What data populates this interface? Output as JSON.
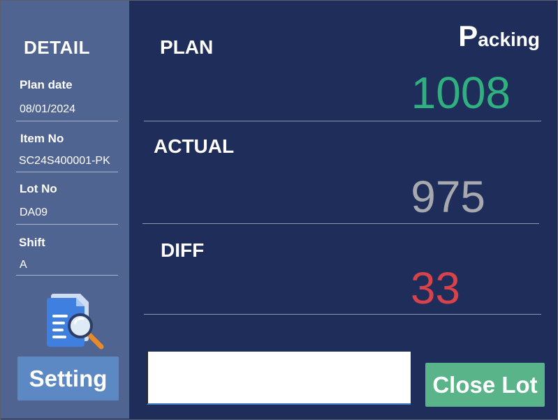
{
  "sidebar": {
    "title": "DETAIL",
    "fields": [
      {
        "label": "Plan date",
        "value": "08/01/2024"
      },
      {
        "label": "Item No",
        "value": "SC24S400001-PK"
      },
      {
        "label": "Lot No",
        "value": "DA09"
      },
      {
        "label": "Shift",
        "value": "A"
      }
    ],
    "setting_label": "Setting",
    "icon": "document-search-icon"
  },
  "header": {
    "title_initial": "P",
    "title_rest": "acking"
  },
  "main": {
    "plan": {
      "label": "PLAN",
      "value": "1008",
      "color": "#2fb07e"
    },
    "actual": {
      "label": "ACTUAL",
      "value": "975",
      "color": "#a7a9ae"
    },
    "diff": {
      "label": "DIFF",
      "value": "33",
      "color": "#d8424a"
    }
  },
  "input": {
    "value": ""
  },
  "close_lot_label": "Close Lot",
  "colors": {
    "main_bg": "#1f2d5a",
    "sidebar_bg": "#506491",
    "setting_btn": "#5c89c4",
    "close_btn": "#59b48a"
  }
}
